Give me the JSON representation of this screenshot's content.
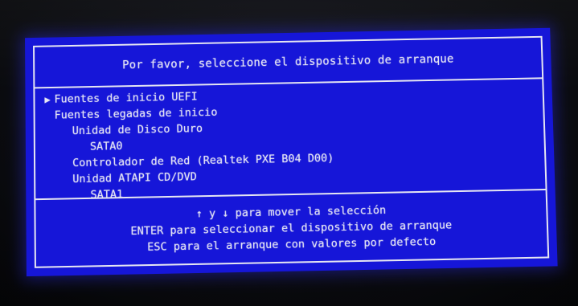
{
  "dialog": {
    "title": "Por favor, seleccione el dispositivo de arranque"
  },
  "menu": {
    "pointer_glyph": "▶",
    "items": [
      {
        "label": "Fuentes de inicio UEFI",
        "selected": true
      },
      {
        "label": "Fuentes legadas de inicio",
        "selected": false
      },
      {
        "label": "Unidad de Disco Duro",
        "selected": false
      },
      {
        "label": "SATA0",
        "selected": false
      },
      {
        "label": "Controlador de Red (Realtek PXE B04 D00)",
        "selected": false
      },
      {
        "label": "Unidad ATAPI CD/DVD",
        "selected": false
      },
      {
        "label": "SATA1",
        "selected": false
      }
    ]
  },
  "help": {
    "line1": "↑ y ↓ para mover la selección",
    "line2": "ENTER para seleccionar el dispositivo de arranque",
    "line3": "ESC para el arranque con valores por defecto"
  },
  "colors": {
    "background": "#1616d8",
    "text": "#e8e8f4",
    "border": "#e6e6f2"
  }
}
